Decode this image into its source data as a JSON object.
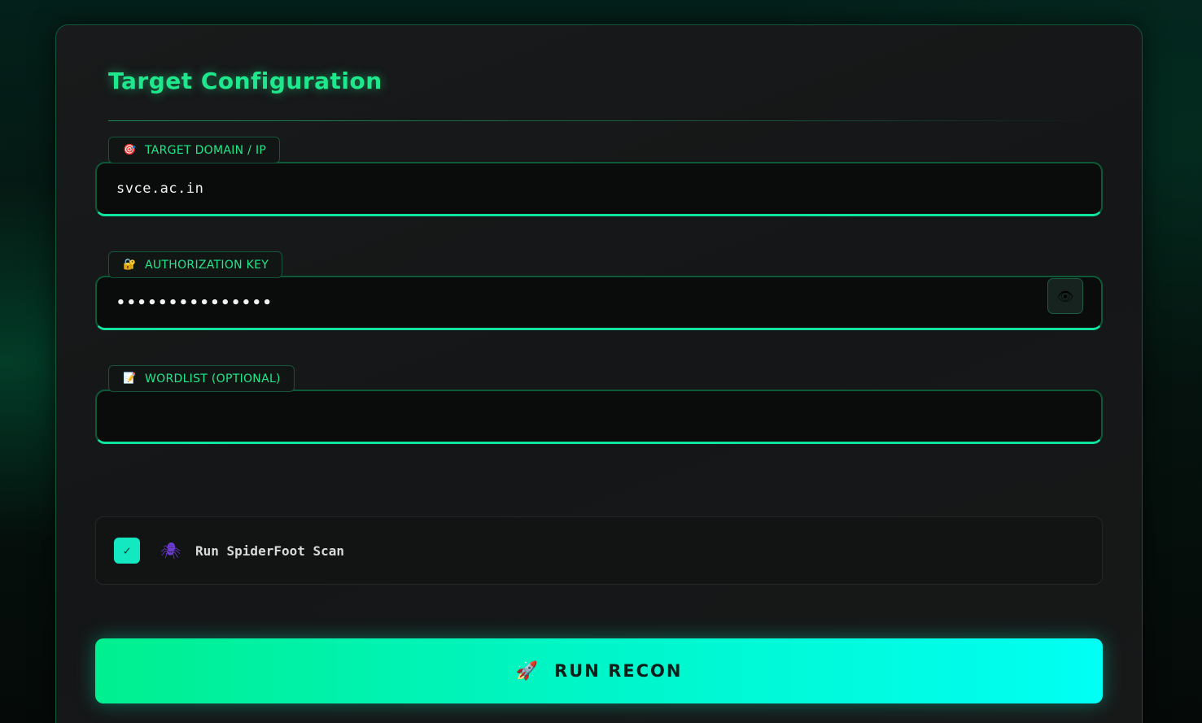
{
  "panel": {
    "title": "Target Configuration"
  },
  "fields": {
    "target": {
      "icon": "target-icon",
      "icon_glyph": "🎯",
      "label": "TARGET DOMAIN / IP",
      "value": "svce.ac.in"
    },
    "auth": {
      "icon": "lock-icon",
      "icon_glyph": "🔐",
      "label": "AUTHORIZATION KEY",
      "value": "•••••••••••••••",
      "toggle_icon": "eye-icon",
      "toggle_glyph": "👁"
    },
    "wordlist": {
      "icon": "memo-icon",
      "icon_glyph": "📝",
      "label": "WORDLIST (OPTIONAL)",
      "value": ""
    }
  },
  "options": {
    "spiderfoot": {
      "checked": true,
      "check_glyph": "✓",
      "icon": "spider-icon",
      "icon_glyph": "🕷",
      "label": "Run SpiderFoot Scan"
    }
  },
  "run_button": {
    "icon": "rocket-icon",
    "icon_glyph": "🚀",
    "label": "RUN RECON"
  },
  "colors": {
    "accent": "#1fe88c",
    "button_start": "#00ef8f",
    "button_end": "#00fff4",
    "checkbox": "#14e8c0"
  }
}
